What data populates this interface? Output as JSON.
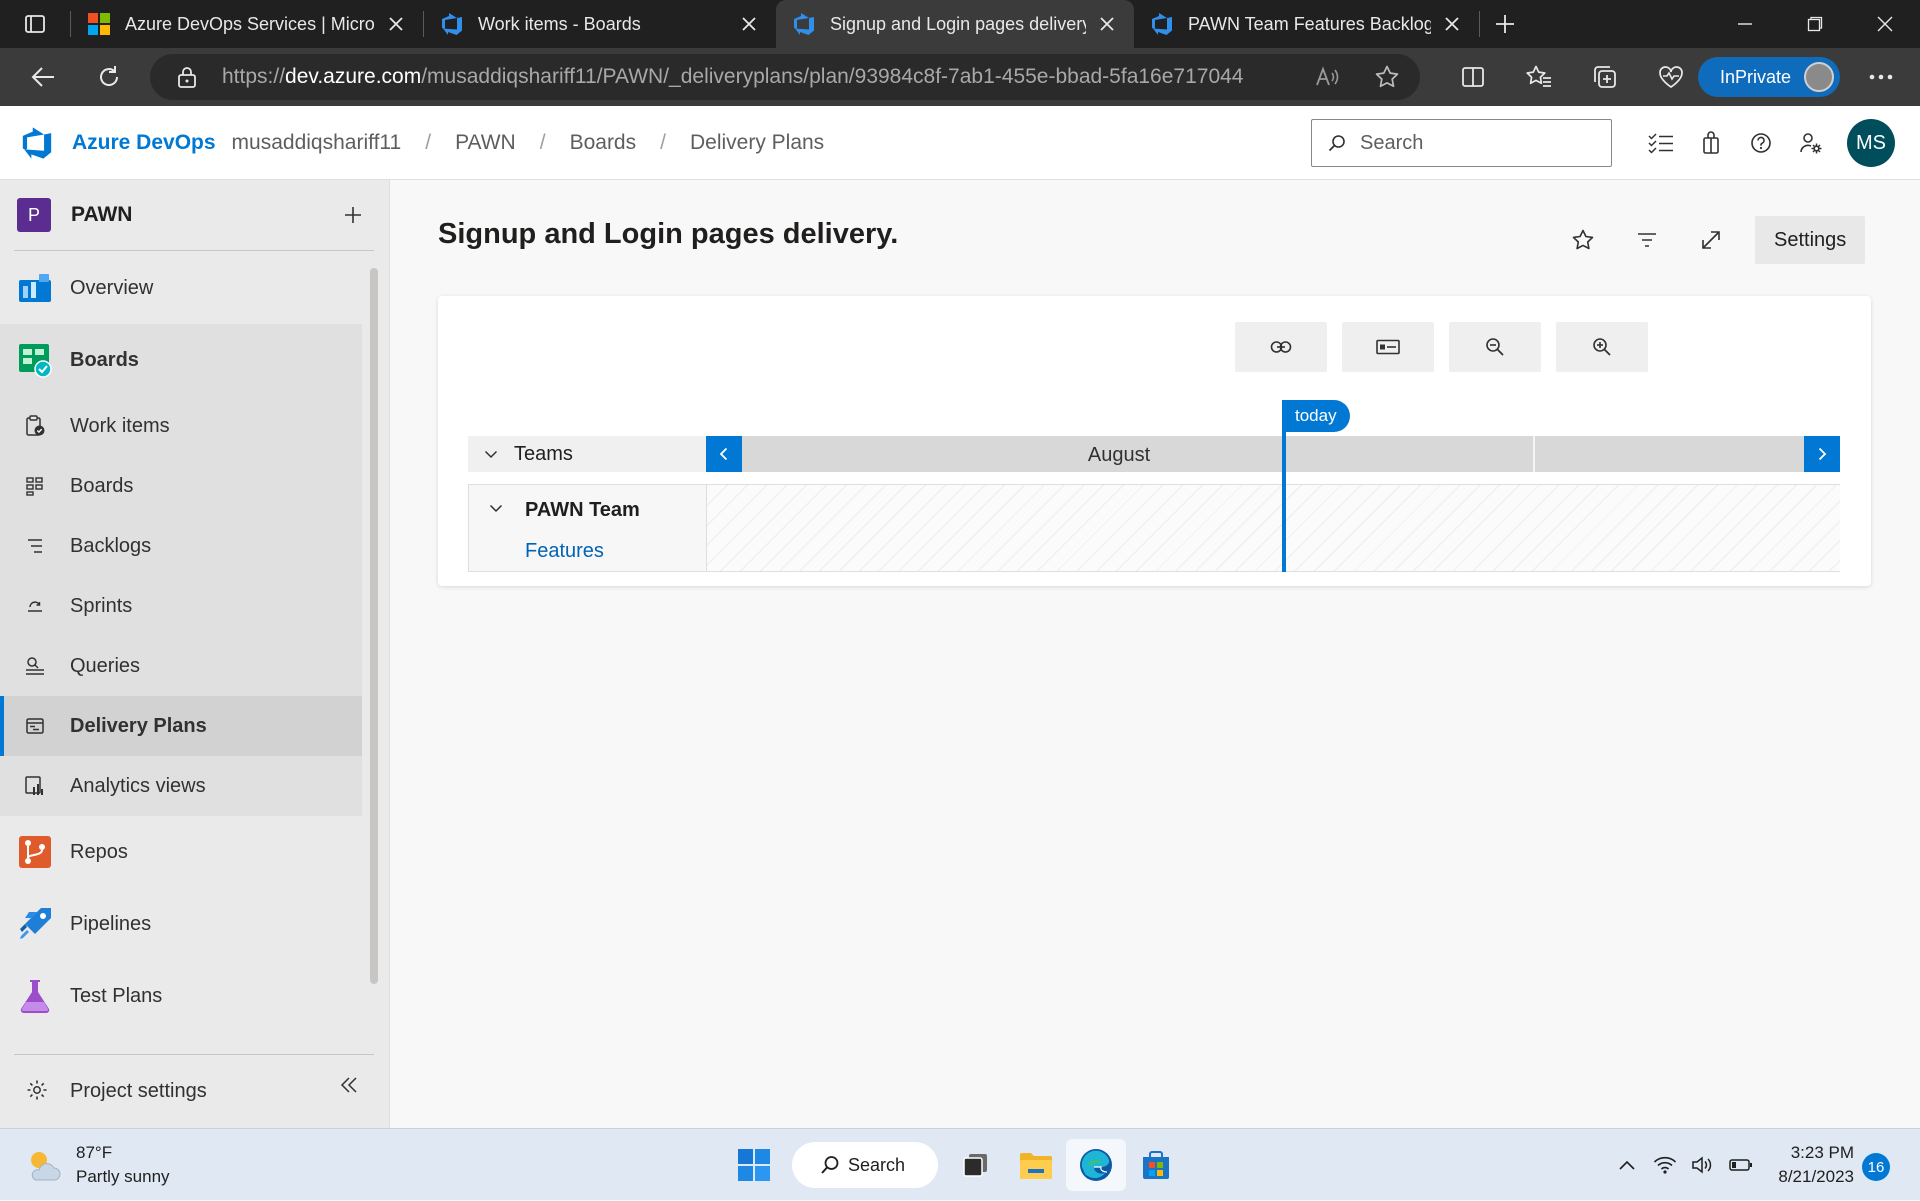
{
  "browser": {
    "tabs": [
      {
        "label": "Azure DevOps Services | Microsoft",
        "icon": "microsoft-logo-icon",
        "active": false
      },
      {
        "label": "Work items - Boards",
        "icon": "azure-devops-icon",
        "active": false
      },
      {
        "label": "Signup and Login pages delivery.",
        "icon": "azure-devops-icon",
        "active": true
      },
      {
        "label": "PAWN Team Features Backlog - Boards",
        "icon": "azure-devops-icon",
        "active": false
      }
    ],
    "url_prefix": "https://",
    "url_domain": "dev.azure.com",
    "url_path": "/musaddiqshariff11/PAWN/_deliveryplans/plan/93984c8f-7ab1-455e-bbad-5fa16e717044",
    "inprivate_label": "InPrivate"
  },
  "header": {
    "brand": "Azure DevOps",
    "breadcrumbs": [
      "musaddiqshariff11",
      "PAWN",
      "Boards",
      "Delivery Plans"
    ],
    "search_placeholder": "Search",
    "avatar_initials": "MS"
  },
  "sidebar": {
    "project_initial": "P",
    "project_name": "PAWN",
    "items": [
      {
        "label": "Overview",
        "icon": "overview-icon"
      },
      {
        "label": "Boards",
        "icon": "boards-service-icon"
      },
      {
        "label": "Work items",
        "icon": "work-items-icon"
      },
      {
        "label": "Boards",
        "icon": "boards-icon"
      },
      {
        "label": "Backlogs",
        "icon": "backlogs-icon"
      },
      {
        "label": "Sprints",
        "icon": "sprints-icon"
      },
      {
        "label": "Queries",
        "icon": "queries-icon"
      },
      {
        "label": "Delivery Plans",
        "icon": "delivery-plans-icon"
      },
      {
        "label": "Analytics views",
        "icon": "analytics-views-icon"
      },
      {
        "label": "Repos",
        "icon": "repos-icon"
      },
      {
        "label": "Pipelines",
        "icon": "pipelines-icon"
      },
      {
        "label": "Test Plans",
        "icon": "test-plans-icon"
      }
    ],
    "project_settings": "Project settings"
  },
  "plan": {
    "title": "Signup and Login pages delivery.",
    "settings_label": "Settings",
    "teams_header": "Teams",
    "month": "August",
    "today_label": "today",
    "team_name": "PAWN Team",
    "backlog_link": "Features"
  },
  "taskbar": {
    "temperature": "87°F",
    "weather": "Partly sunny",
    "search_label": "Search",
    "time": "3:23 PM",
    "date": "8/21/2023",
    "notification_count": "16"
  },
  "colors": {
    "accent": "#0078d4",
    "project_badge": "#5c2d91",
    "avatar": "#004e5c",
    "link": "#0064b5"
  }
}
